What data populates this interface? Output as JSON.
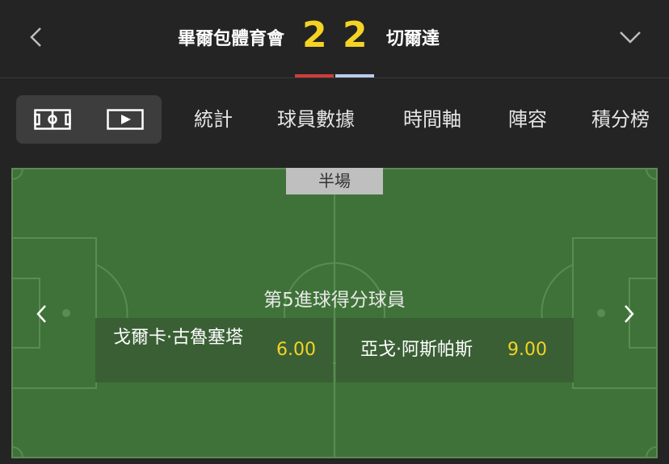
{
  "header": {
    "home_team": "畢爾包體育會",
    "away_team": "切爾達",
    "home_score": "2",
    "away_score": "2",
    "home_color": "#d23b3b",
    "away_color": "#b8cdea",
    "back_icon": "chevron-left-icon",
    "collapse_icon": "chevron-down-icon"
  },
  "tabs": {
    "view_toggle": [
      "pitch-icon",
      "play-video-icon"
    ],
    "items": [
      {
        "label": "統計"
      },
      {
        "label": "球員數據"
      },
      {
        "label": "時間軸"
      },
      {
        "label": "陣容"
      },
      {
        "label": "積分榜"
      }
    ]
  },
  "pitch": {
    "period": "半場",
    "scorer_title": "第5進球得分球員",
    "home": {
      "player": "戈爾卡·古魯塞塔",
      "odds": "6.00"
    },
    "away": {
      "player": "亞戈·阿斯帕斯",
      "odds": "9.00"
    },
    "accent_color": "#f5d325"
  }
}
